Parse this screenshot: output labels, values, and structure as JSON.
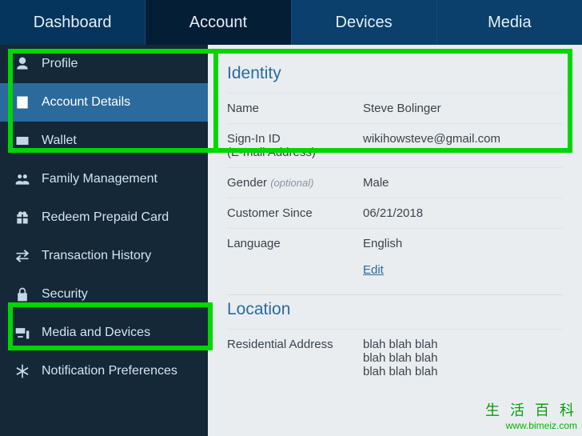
{
  "tabs": [
    {
      "key": "dashboard",
      "label": "Dashboard",
      "active": false
    },
    {
      "key": "account",
      "label": "Account",
      "active": true
    },
    {
      "key": "devices",
      "label": "Devices",
      "active": false
    },
    {
      "key": "media",
      "label": "Media",
      "active": false
    }
  ],
  "sidebar": {
    "items": [
      {
        "key": "profile",
        "label": "Profile",
        "icon": "person-icon",
        "active": false
      },
      {
        "key": "account-details",
        "label": "Account Details",
        "icon": "document-icon",
        "active": true
      },
      {
        "key": "wallet",
        "label": "Wallet",
        "icon": "wallet-icon",
        "active": false
      },
      {
        "key": "family",
        "label": "Family Management",
        "icon": "family-icon",
        "active": false
      },
      {
        "key": "redeem",
        "label": "Redeem Prepaid Card",
        "icon": "gift-icon",
        "active": false
      },
      {
        "key": "transactions",
        "label": "Transaction History",
        "icon": "transfer-icon",
        "active": false
      },
      {
        "key": "security",
        "label": "Security",
        "icon": "lock-icon",
        "active": false
      },
      {
        "key": "media-devices",
        "label": "Media and Devices",
        "icon": "devices-icon",
        "active": false
      },
      {
        "key": "notifications",
        "label": "Notification Preferences",
        "icon": "asterisk-icon",
        "active": false
      }
    ]
  },
  "identity": {
    "title": "Identity",
    "name_label": "Name",
    "name_value": "Steve Bolinger",
    "signin_label": "Sign-In ID",
    "signin_sublabel": "(E-mail Address)",
    "signin_value": "wikihowsteve@gmail.com",
    "gender_label": "Gender",
    "gender_optional": "(optional)",
    "gender_value": "Male",
    "customer_since_label": "Customer Since",
    "customer_since_value": "06/21/2018",
    "language_label": "Language",
    "language_value": "English",
    "edit_label": "Edit"
  },
  "location": {
    "title": "Location",
    "address_label": "Residential Address",
    "address_lines": [
      "blah blah blah",
      "blah blah blah",
      "blah blah blah"
    ]
  },
  "watermark": {
    "cn": "生 活 百 科",
    "url": "www.bimeiz.com"
  }
}
